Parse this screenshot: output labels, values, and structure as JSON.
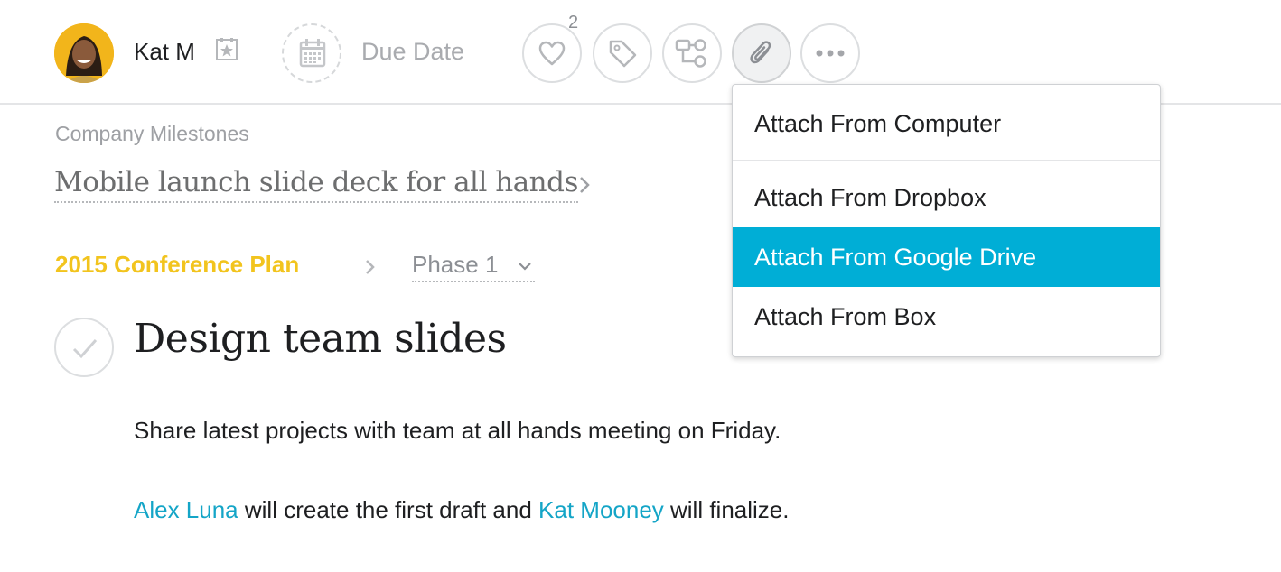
{
  "assignee": {
    "name": "Kat M"
  },
  "due_date": {
    "label": "Due Date"
  },
  "toolbar": {
    "like_count": "2"
  },
  "attach_menu": {
    "items": [
      {
        "label": "Attach From Computer"
      },
      {
        "label": "Attach From Dropbox"
      },
      {
        "label": "Attach From Google Drive",
        "highlighted": true
      },
      {
        "label": "Attach From Box"
      }
    ]
  },
  "project": {
    "label": "Company Milestones",
    "parent_task": "Mobile launch slide deck for all hands"
  },
  "breadcrumb": {
    "project_name": "2015 Conference Plan",
    "section": "Phase 1"
  },
  "task": {
    "title": "Design team slides",
    "description": {
      "line1": "Share latest projects with team at all hands meeting on Friday.",
      "mention1": "Alex Luna",
      "middle": " will create the first draft and ",
      "mention2": "Kat Mooney",
      "end": " will finalize."
    }
  },
  "colors": {
    "accent": "#00aed6",
    "mention": "#14a5c7",
    "project_yellow": "#f2c41e",
    "avatar_bg": "#f2b51b"
  },
  "icons": [
    "user-avatar",
    "assignee-star-icon",
    "calendar-icon",
    "heart-icon",
    "tag-icon",
    "subtask-icon",
    "paperclip-icon",
    "more-icon",
    "chevron-right-icon",
    "chevron-down-icon",
    "checkmark-icon"
  ]
}
